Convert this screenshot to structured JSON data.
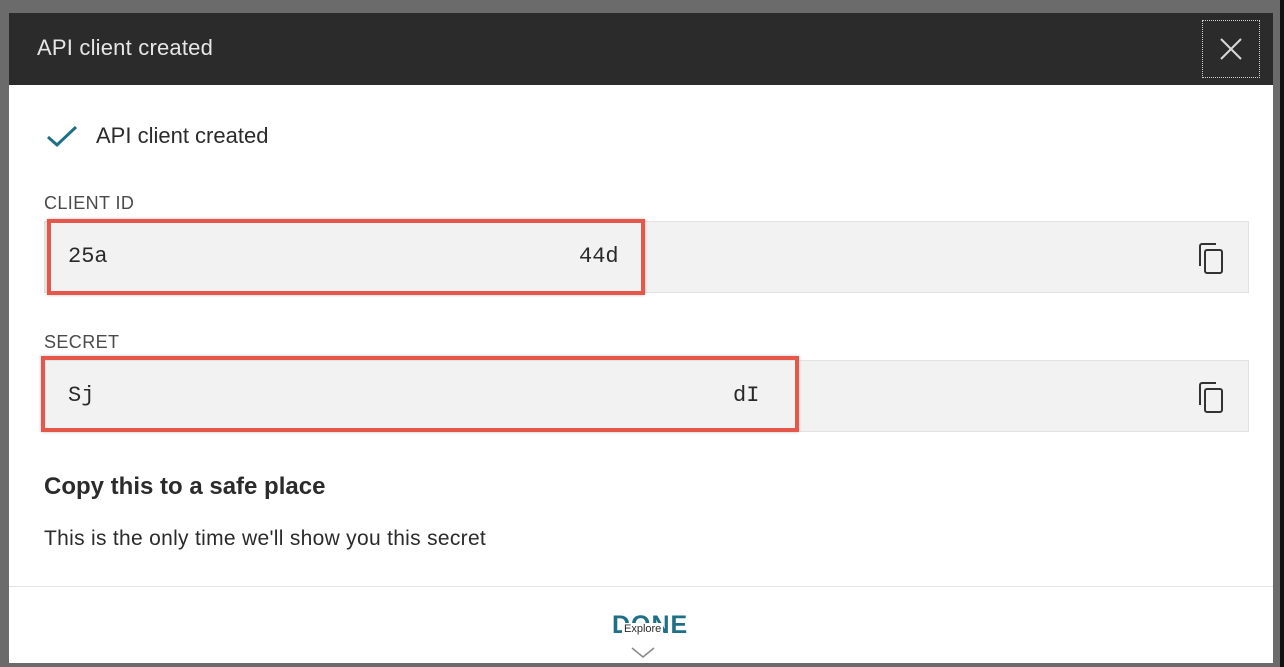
{
  "dialog": {
    "title": "API client created",
    "close_icon": "close-icon"
  },
  "status": {
    "icon": "check-icon",
    "message": "API client created",
    "color": "#1f6f86"
  },
  "client_id": {
    "label": "CLIENT ID",
    "value_start": "25a",
    "value_end": "44d",
    "copy_icon": "copy-icon"
  },
  "secret": {
    "label": "SECRET",
    "value_start": "Sj",
    "value_end": "dI",
    "copy_icon": "copy-icon"
  },
  "notice": {
    "title": "Copy this to a safe place",
    "text": "This is the only time we'll show you this secret"
  },
  "footer": {
    "done_label": "DONE",
    "explore_label": "Explore"
  },
  "colors": {
    "header_bg": "#2b2b2c",
    "highlight": "#e5564b",
    "accent": "#1f6f86"
  }
}
